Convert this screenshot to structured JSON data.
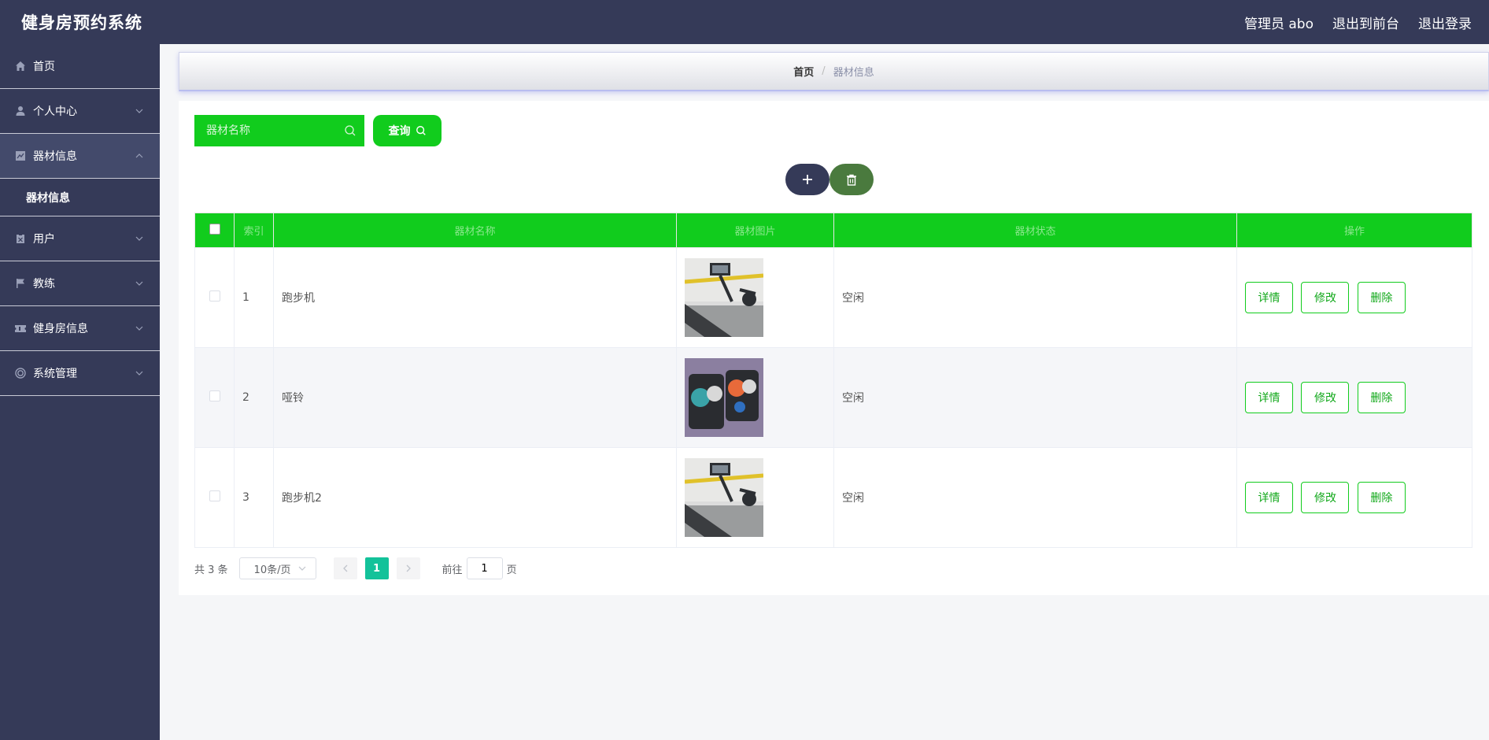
{
  "app": {
    "title": "健身房预约系统"
  },
  "header": {
    "user_label": "管理员 abo",
    "front_link": "退出到前台",
    "logout_link": "退出登录"
  },
  "sidebar": {
    "items": [
      {
        "label": "首页",
        "icon": "home-icon"
      },
      {
        "label": "个人中心",
        "icon": "user-icon"
      },
      {
        "label": "器材信息",
        "icon": "chart-icon",
        "expanded": true,
        "sub": "器材信息"
      },
      {
        "label": "用户",
        "icon": "clipboard-icon"
      },
      {
        "label": "教练",
        "icon": "flag-icon"
      },
      {
        "label": "健身房信息",
        "icon": "ticket-icon"
      },
      {
        "label": "系统管理",
        "icon": "settings-icon"
      }
    ]
  },
  "breadcrumb": {
    "home": "首页",
    "separator": "/",
    "current": "器材信息"
  },
  "search": {
    "placeholder": "器材名称",
    "button_label": "查询"
  },
  "table": {
    "headers": {
      "index": "索引",
      "name": "器材名称",
      "image": "器材图片",
      "status": "器材状态",
      "actions": "操作"
    },
    "rows": [
      {
        "index": "1",
        "name": "跑步机",
        "image": "treadmill",
        "status": "空闲"
      },
      {
        "index": "2",
        "name": "哑铃",
        "image": "dumbbells",
        "status": "空闲"
      },
      {
        "index": "3",
        "name": "跑步机2",
        "image": "treadmill",
        "status": "空闲"
      }
    ],
    "actions": {
      "detail": "详情",
      "edit": "修改",
      "delete": "删除"
    }
  },
  "pagination": {
    "total": "共 3 条",
    "page_size": "10条/页",
    "current_page": "1",
    "goto_pre": "前往",
    "goto_value": "1",
    "goto_post": "页"
  },
  "colors": {
    "accent": "#11cc1d",
    "nav": "#353a58",
    "pager_active": "#13c29a",
    "delete_btn": "#4a7a3e"
  }
}
